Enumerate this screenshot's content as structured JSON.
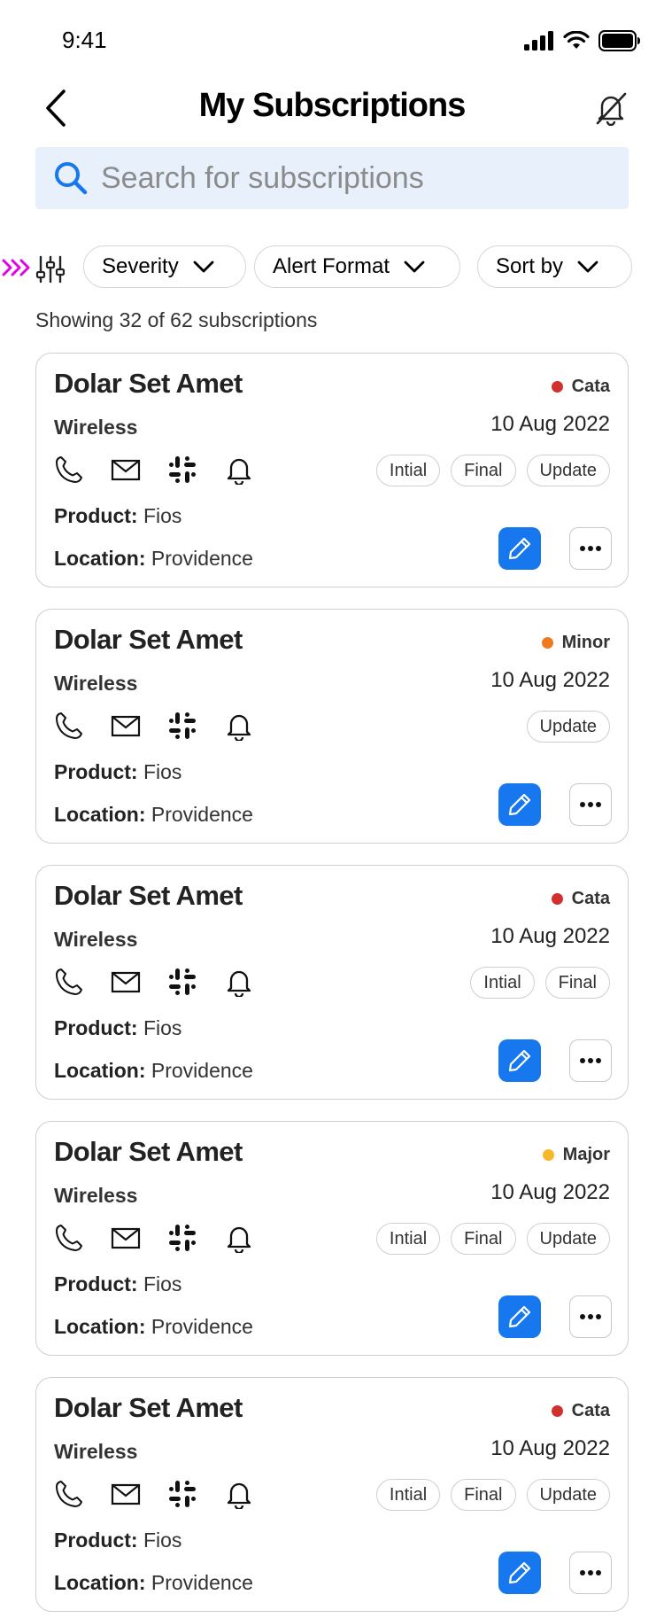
{
  "status": {
    "time": "9:41"
  },
  "header": {
    "title": "My Subscriptions"
  },
  "search": {
    "placeholder": "Search for subscriptions",
    "value": ""
  },
  "filters": {
    "severity": "Severity",
    "alert_format": "Alert Format",
    "sort_by": "Sort by"
  },
  "results": {
    "count_text": "Showing 32 of 62 subscriptions"
  },
  "labels": {
    "product": "Product:",
    "location": "Location:"
  },
  "colors": {
    "accent": "#1677ee",
    "search_bg": "#e7f0fb",
    "cata": "#d0312d",
    "minor": "#ee7a1d",
    "major": "#f5b829",
    "chevron": "#e600e6"
  },
  "icons": [
    "back-icon",
    "bell-slash-icon",
    "search-icon",
    "chevrons-icon",
    "sliders-icon",
    "chevron-down-icon",
    "phone-icon",
    "mail-icon",
    "slack-icon",
    "bell-icon",
    "pencil-icon",
    "ellipsis-icon"
  ],
  "cards": [
    {
      "title": "Dolar Set Amet",
      "severity": "Cata",
      "severity_color": "#d0312d",
      "sub": "Wireless",
      "date": "10 Aug 2022",
      "tags": [
        "Intial",
        "Final",
        "Update"
      ],
      "product": "Fios",
      "location": "Providence"
    },
    {
      "title": "Dolar Set Amet",
      "severity": "Minor",
      "severity_color": "#ee7a1d",
      "sub": "Wireless",
      "date": "10 Aug 2022",
      "tags": [
        "Update"
      ],
      "product": "Fios",
      "location": "Providence"
    },
    {
      "title": "Dolar Set Amet",
      "severity": "Cata",
      "severity_color": "#d0312d",
      "sub": "Wireless",
      "date": "10 Aug 2022",
      "tags": [
        "Intial",
        "Final"
      ],
      "product": "Fios",
      "location": "Providence"
    },
    {
      "title": "Dolar Set Amet",
      "severity": "Major",
      "severity_color": "#f5b829",
      "sub": "Wireless",
      "date": "10 Aug 2022",
      "tags": [
        "Intial",
        "Final",
        "Update"
      ],
      "product": "Fios",
      "location": "Providence"
    },
    {
      "title": "Dolar Set Amet",
      "severity": "Cata",
      "severity_color": "#d0312d",
      "sub": "Wireless",
      "date": "10 Aug 2022",
      "tags": [
        "Intial",
        "Final",
        "Update"
      ],
      "product": "Fios",
      "location": "Providence"
    }
  ]
}
